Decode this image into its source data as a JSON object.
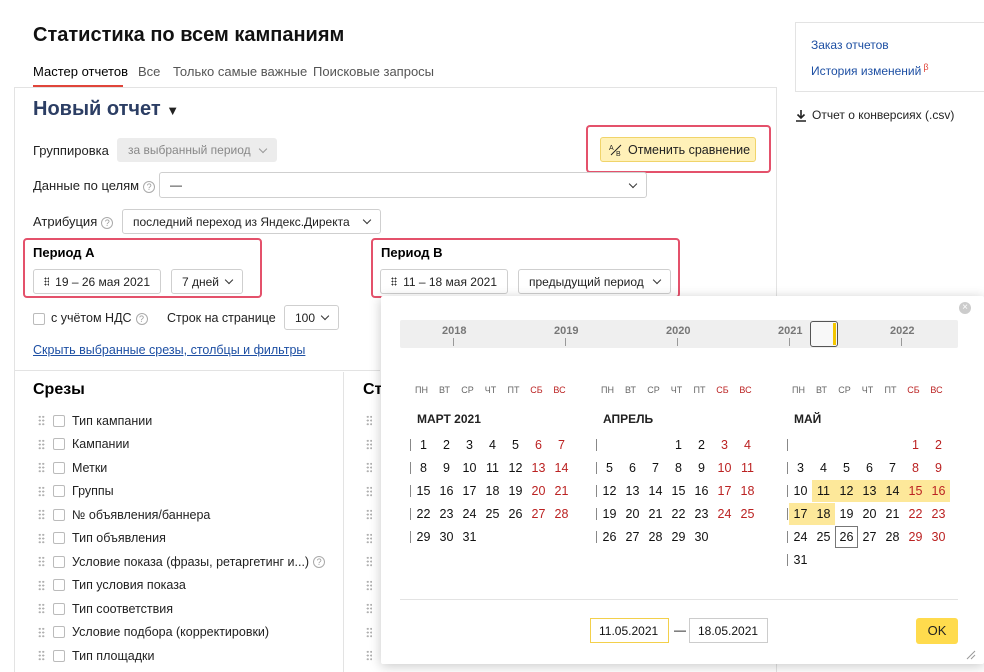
{
  "header": {
    "title": "Статистика по всем кампаниям",
    "tabs": [
      "Мастер отчетов",
      "Все",
      "Только самые важные",
      "Поисковые запросы"
    ]
  },
  "right_panel": {
    "links": [
      "Заказ отчетов",
      "История изменений"
    ],
    "beta": "β",
    "download": "Отчет о конверсиях (.csv)"
  },
  "report": {
    "title": "Новый отчет",
    "title_arrow": "▼",
    "grouping_label": "Группировка",
    "grouping_value": "за выбранный период",
    "compare_button": "Отменить сравнение",
    "goals_label": "Данные по целям",
    "goals_value": "—",
    "attribution_label": "Атрибуция",
    "attribution_value": "последний переход из Яндекс.Директа",
    "period_a_label": "Период А",
    "period_a_range": "19 – 26 мая 2021",
    "period_a_preset": "7 дней",
    "period_b_label": "Период B",
    "period_b_range": "11 – 18 мая 2021",
    "period_b_preset": "предыдущий период",
    "vat_label": "с учётом НДС",
    "rows_label": "Строк на странице",
    "rows_value": "100",
    "hide_link": "Скрыть выбранные срезы, столбцы и фильтры"
  },
  "slices": {
    "title": "Срезы",
    "second_title": "Ст",
    "items": [
      "Тип кампании",
      "Кампании",
      "Метки",
      "Группы",
      "№ объявления/баннера",
      "Тип объявления",
      "Условие показа (фразы, ретаргетинг и...)",
      "Тип условия показа",
      "Тип соответствия",
      "Условие подбора (корректировки)",
      "Тип площадки"
    ]
  },
  "calendar": {
    "years": [
      "2018",
      "2019",
      "2020",
      "2021",
      "2022"
    ],
    "weekdays": [
      "ПН",
      "ВТ",
      "СР",
      "ЧТ",
      "ПТ",
      "СБ",
      "ВС"
    ],
    "months": [
      {
        "title": "МАРТ 2021",
        "start": 0,
        "days": 31
      },
      {
        "title": "АПРЕЛЬ",
        "start": 3,
        "days": 30
      },
      {
        "title": "МАЙ",
        "start": 5,
        "days": 31
      }
    ],
    "selected": [
      11,
      12,
      13,
      14,
      15,
      16,
      17,
      18
    ],
    "today": 26,
    "date_from": "11.05.2021",
    "date_sep": "—",
    "date_to": "18.05.2021",
    "ok": "OK"
  },
  "colors": {
    "accent": "#e0453a",
    "highlight": "#e4516b",
    "selection": "#fde89a",
    "button": "#ffdb4d",
    "link": "#1d4fa3"
  }
}
